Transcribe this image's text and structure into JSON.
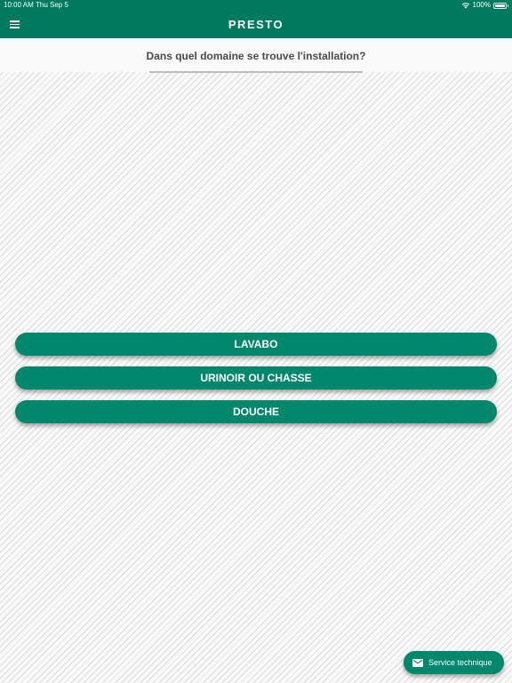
{
  "status_bar": {
    "time": "10:00 AM",
    "date": "Thu Sep 5",
    "battery": "100%",
    "wifi_icon": "wifi-icon",
    "battery_icon": "battery-icon"
  },
  "app_bar": {
    "title": "PRESTO",
    "menu_icon": "hamburger-menu-icon",
    "background": "#007a5e"
  },
  "question": {
    "text": "Dans quel domaine se trouve l'installation?"
  },
  "choices": [
    {
      "label": "LAVABO"
    },
    {
      "label": "URINOIR OU CHASSE"
    },
    {
      "label": "DOUCHE"
    }
  ],
  "fab": {
    "label": "Service technique",
    "icon": "mail-icon",
    "color": "#00876c"
  },
  "colors": {
    "button": "#00876c",
    "text_on_accent": "#ffffff",
    "question_text": "#4a4a4a"
  }
}
